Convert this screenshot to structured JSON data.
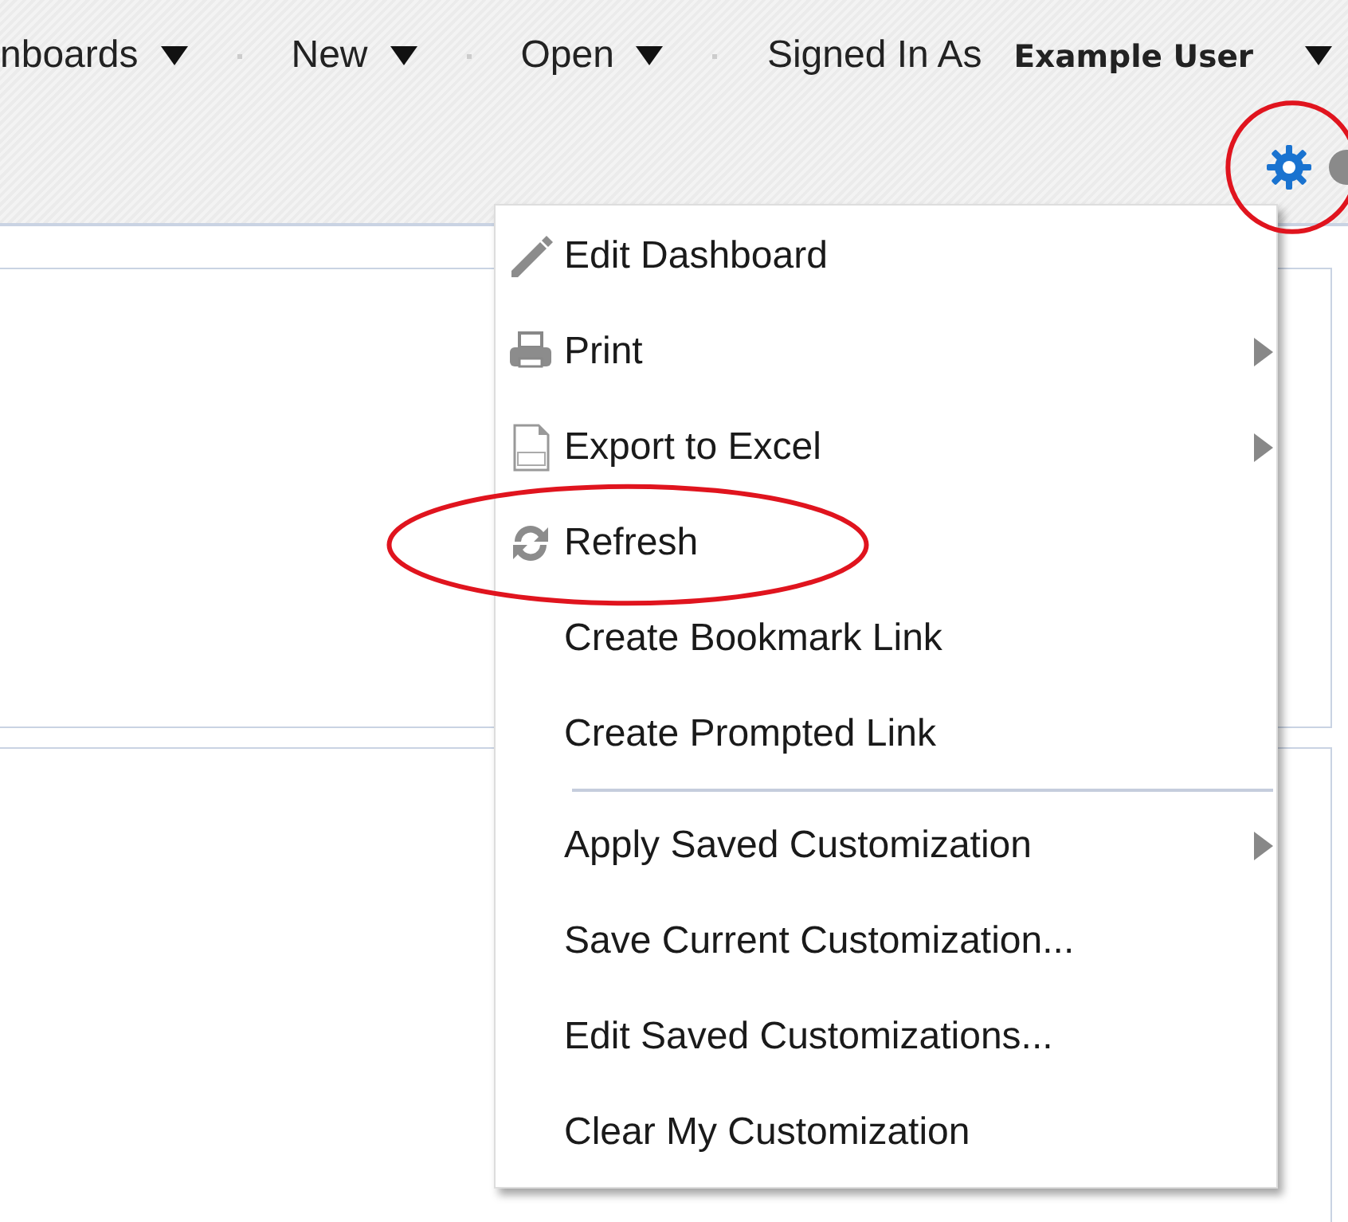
{
  "header": {
    "menus": [
      {
        "label": "nboards"
      },
      {
        "label": "New"
      },
      {
        "label": "Open"
      }
    ],
    "signed_in_label": "Signed In As",
    "user": "Example User"
  },
  "toolbar": {
    "settings": {
      "highlight": true
    }
  },
  "menu": {
    "items": [
      {
        "label": "Edit Dashboard",
        "submenu": false,
        "separator_before": false,
        "highlight": false
      },
      {
        "label": "Print",
        "submenu": true,
        "separator_before": false,
        "highlight": false
      },
      {
        "label": "Export to Excel",
        "submenu": true,
        "separator_before": false,
        "highlight": false
      },
      {
        "label": "Refresh",
        "submenu": false,
        "separator_before": false,
        "highlight": true
      },
      {
        "label": "Create Bookmark Link",
        "submenu": false,
        "separator_before": false,
        "highlight": false
      },
      {
        "label": "Create Prompted Link",
        "submenu": false,
        "separator_before": false,
        "highlight": false
      },
      {
        "label": "Apply Saved Customization",
        "submenu": true,
        "separator_before": true,
        "highlight": false
      },
      {
        "label": "Save Current Customization...",
        "submenu": false,
        "separator_before": false,
        "highlight": false
      },
      {
        "label": "Edit Saved Customizations...",
        "submenu": false,
        "separator_before": false,
        "highlight": false
      },
      {
        "label": "Clear My Customization",
        "submenu": false,
        "separator_before": false,
        "highlight": false
      }
    ]
  }
}
